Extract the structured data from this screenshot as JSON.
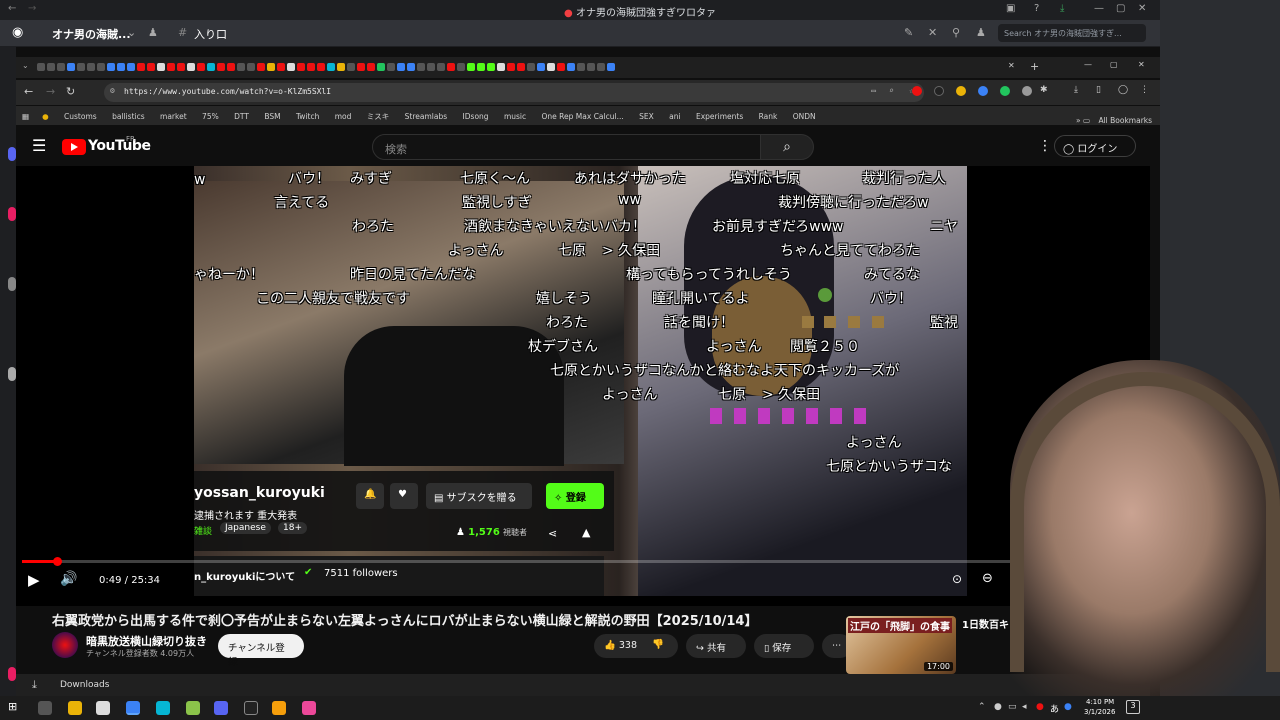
{
  "discord": {
    "window_title": "オナ男の海賊団強すぎワロタァ",
    "server_name": "オナ男の海賊...",
    "channel_name": "入り口",
    "search_placeholder": "Search オナ男の海賊団強すぎ..."
  },
  "browser": {
    "url": "https://www.youtube.com/watch?v=o-KlZm5SXlI",
    "bookmarks": [
      "Customs",
      "ballistics",
      "market",
      "75%",
      "DTT",
      "BSM",
      "Twitch",
      "mod",
      "ミスキ",
      "Streamlabs",
      "IDsong",
      "music",
      "One Rep Max Calcul...",
      "SEX",
      "ani",
      "Experiments",
      "Rank",
      "ONDN"
    ],
    "all_bookmarks": "All Bookmarks"
  },
  "youtube": {
    "logo": "YouTube",
    "region": "FR",
    "search_placeholder": "検索",
    "login_label": "ログイン",
    "overlay": {
      "channel_handle": "yossan_kuroyuki",
      "stream_title": "逮捕されます 重大発表",
      "tag_category": "雑談",
      "tag_language": "Japanese",
      "tag_age": "18+",
      "gift_label": "サブスクを贈る",
      "subscribe_label": "登録",
      "viewers": "1,576",
      "viewers_label": "視聴者",
      "about_label": "n_kuroyukiについて",
      "followers": "7511 followers"
    },
    "comments": [
      "バウ！",
      "みすぎ",
      "七原く〜ん",
      "あれはダサかった",
      "塩対応七原",
      "裁判行った人",
      "言えてる",
      "監視しすぎ",
      "ww",
      "裁判傍聴に行っただろw",
      "わろた",
      "酒飲まなきゃいえないバカ！",
      "お前見すぎだろwww",
      "ニヤ",
      "よっさん",
      "七原",
      "> 久保田",
      "ちゃんと見ててわろた",
      "ゃねーか！",
      "昨日の見てたんだな",
      "構ってもらってうれしそう",
      "みてるな",
      "この二人親友で戦友です",
      "嬉しそう",
      "瞳孔開いてるよ",
      "バウ！",
      "わろた",
      "話を聞け！",
      "監視",
      "杖デブさん",
      "よっさん",
      "閲覧２５０",
      "七原とかいうザコなんかと絡むなよ天下のキッカーズが",
      "よっさん",
      "七原",
      "> 久保田",
      "よっさん",
      "七原とかいうザコな"
    ],
    "time_current": "0:49",
    "time_total": "25:34",
    "progress_fraction": 0.032,
    "video_title": "右翼政党から出馬する件で刹〇予告が止まらない左翼よっさんにロバが止まらない横山緑と解説の野田【2025/10/14】",
    "channel_name": "暗黒放送横山緑切り抜き",
    "subscribers": "チャンネル登録者数 4.09万人",
    "subscribe_button": "チャンネル登録",
    "likes": "338",
    "share_label": "共有",
    "save_label": "保存",
    "next_video": {
      "thumb_text": "江戸の「飛脚」の食事",
      "duration": "17:00",
      "title_fragment": "1日数百キ"
    },
    "downloads_label": "Downloads"
  },
  "taskbar": {
    "time": "4:10 PM",
    "date": "3/1/2026",
    "ime": "あ",
    "notif_count": "3"
  },
  "colors": {
    "youtube_red": "#ff0000",
    "subscribe_green": "#00d26a",
    "discord_bg": "#313338",
    "kick_green": "#53fc18"
  }
}
